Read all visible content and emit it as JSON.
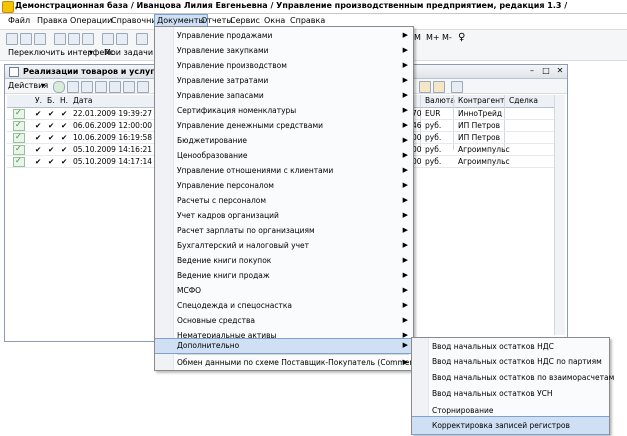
{
  "window": {
    "title": "Демонстрационная база / Иванцова Лилия Евгеньевна / Управление производственным предприятием, редакция 1.3 /"
  },
  "menubar": {
    "items": [
      "Файл",
      "Правка",
      "Операции",
      "Справочники",
      "Документы",
      "Отчеты",
      "Сервис",
      "Окна",
      "Справка"
    ],
    "active": "Документы"
  },
  "toolbar": {
    "mem_buttons": [
      "M",
      "M+",
      "M-"
    ]
  },
  "toolbar2": {
    "switch_interface": "Переключить интерфейс",
    "my_tasks": "Мои задачи"
  },
  "doc": {
    "title": "Реализации товаров и услуг",
    "actions": "Действия",
    "columns": [
      "У.",
      "Б.",
      "Н.",
      "Дата",
      "Валюта",
      "Контрагент",
      "Сделка"
    ],
    "rows": [
      {
        "date": "22.01.2009 19:39:27",
        "amount_tail": "70",
        "currency": "EUR",
        "counterparty": "ИнноТрейд"
      },
      {
        "date": "06.06.2009 12:00:00",
        "amount_tail": "46",
        "currency": "руб.",
        "counterparty": "ИП Петров"
      },
      {
        "date": "10.06.2009 16:19:58",
        "amount_tail": "00",
        "currency": "руб.",
        "counterparty": "ИП Петров"
      },
      {
        "date": "05.10.2009 14:16:21",
        "amount_tail": "00",
        "currency": "руб.",
        "counterparty": "Агроимпульс"
      },
      {
        "date": "05.10.2009 14:17:14",
        "amount_tail": "00",
        "currency": "руб.",
        "counterparty": "Агроимпульс"
      }
    ]
  },
  "menu": {
    "items": [
      "Управление продажами",
      "Управление закупками",
      "Управление производством",
      "Управление затратами",
      "Управление запасами",
      "Сертификация номенклатуры",
      "Управление денежными средствами",
      "Бюджетирование",
      "Ценообразование",
      "Управление отношениями с клиентами",
      "Управление персоналом",
      "Расчеты с персоналом",
      "Учет кадров организаций",
      "Расчет зарплаты по организациям",
      "Бухгалтерский и налоговый учет",
      "Ведение книги покупок",
      "Ведение книги продаж",
      "МСФО",
      "Спецодежда и спецоснастка",
      "Основные средства",
      "Нематериальные активы",
      "Дополнительно"
    ],
    "exchange": "Обмен данными по схеме Поставщик-Покупатель (CommerceML)",
    "selected": "Дополнительно"
  },
  "submenu": {
    "items": [
      "Ввод начальных остатков НДС",
      "Ввод начальных остатков НДС по партиям",
      "Ввод начальных остатков по взаиморасчетам",
      "Ввод начальных остатков УСН",
      "Сторнирование",
      "Корректировка записей регистров"
    ],
    "selected": "Корректировка записей регистров"
  }
}
